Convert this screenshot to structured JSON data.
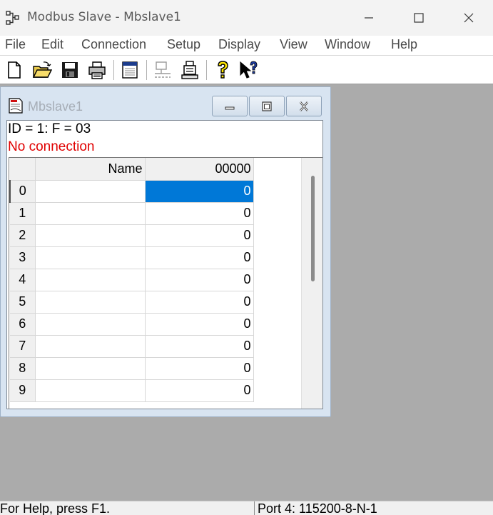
{
  "window": {
    "title": "Modbus Slave - Mbslave1"
  },
  "menu": {
    "items": [
      "File",
      "Edit",
      "Connection",
      "Setup",
      "Display",
      "View",
      "Window",
      "Help"
    ]
  },
  "toolbar": {
    "icons": [
      "new-document-icon",
      "open-folder-icon",
      "save-disk-icon",
      "print-icon",
      "window-icon",
      "connect-icon",
      "disconnect-icon",
      "help-icon",
      "context-help-icon"
    ]
  },
  "child": {
    "title": "Mbslave1",
    "info_line": "ID = 1: F = 03",
    "status_text": "No connection",
    "status_color": "#e00000"
  },
  "grid": {
    "header_name": "Name",
    "header_address": "00000",
    "rows": [
      {
        "index": "0",
        "name": "",
        "value": "0"
      },
      {
        "index": "1",
        "name": "",
        "value": "0"
      },
      {
        "index": "2",
        "name": "",
        "value": "0"
      },
      {
        "index": "3",
        "name": "",
        "value": "0"
      },
      {
        "index": "4",
        "name": "",
        "value": "0"
      },
      {
        "index": "5",
        "name": "",
        "value": "0"
      },
      {
        "index": "6",
        "name": "",
        "value": "0"
      },
      {
        "index": "7",
        "name": "",
        "value": "0"
      },
      {
        "index": "8",
        "name": "",
        "value": "0"
      },
      {
        "index": "9",
        "name": "",
        "value": "0"
      }
    ],
    "selected_row": 0,
    "selection_color": "#0078d7"
  },
  "statusbar": {
    "help_text": "For Help, press F1.",
    "port_text": "Port 4: 115200-8-N-1"
  }
}
